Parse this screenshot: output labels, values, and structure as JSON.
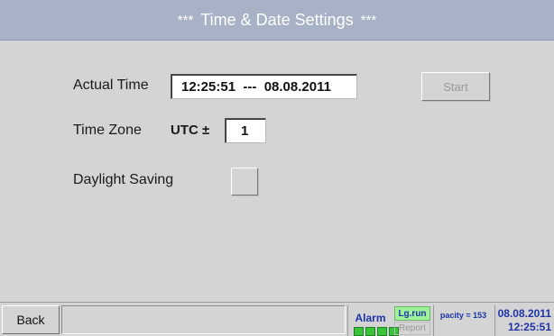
{
  "header": {
    "title": "Time & Date Settings",
    "stars_left": "***",
    "stars_right": "***"
  },
  "form": {
    "actual_time_label": "Actual Time",
    "actual_time_value": "12:25:51  ---  08.08.2011",
    "start_label": "Start",
    "time_zone_label": "Time Zone",
    "utc_label": "UTC ±",
    "time_zone_value": "1",
    "daylight_saving_label": "Daylight Saving",
    "daylight_saving_checked": false
  },
  "statusbar": {
    "back_label": "Back",
    "alarm_label": "Alarm",
    "lgrun_label": "Lg.run",
    "report_label": "Report",
    "capacity_text": "pacity = 153",
    "date": "08.08.2011",
    "time": "12:25:51"
  },
  "colors": {
    "title_bar": "#a7b2c6",
    "panel": "#d4d4d4",
    "status_text": "#1d33a8",
    "lgrun_bg": "#9ef29a",
    "led_green": "#39c43a"
  }
}
